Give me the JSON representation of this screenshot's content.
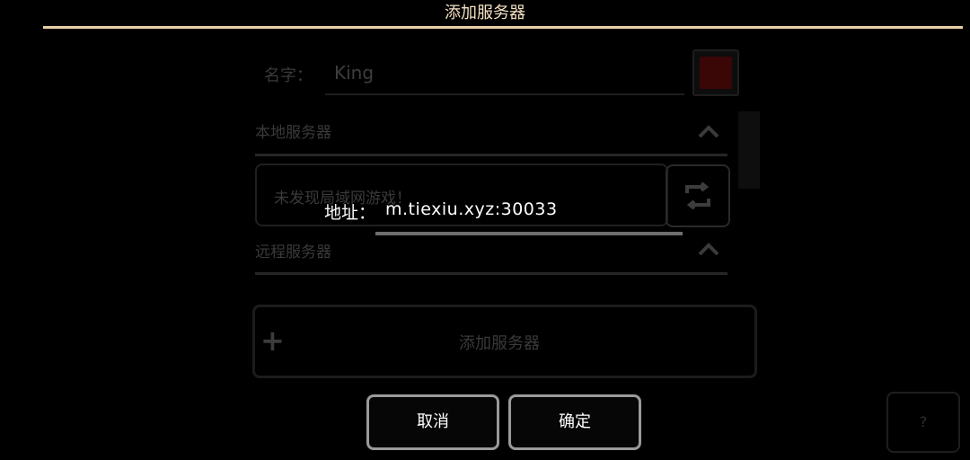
{
  "header": {
    "title": "添加服务器"
  },
  "form": {
    "name_label": "名字：",
    "name_value": "King",
    "address_label": "地址：",
    "address_value": "m.tiexiu.xyz:30033"
  },
  "sections": {
    "local": {
      "title": "本地服务器",
      "empty_text": "未发现局域网游戏！"
    },
    "remote": {
      "title": "远程服务器"
    }
  },
  "buttons": {
    "add_server": "添加服务器",
    "add_icon": "+",
    "cancel": "取消",
    "confirm": "确定",
    "help": "?"
  },
  "colors": {
    "accent": "#e8cfa4",
    "selected_color": "#3a0606",
    "background": "#000000"
  },
  "icons": [
    "chevron-up-icon",
    "refresh-icon",
    "plus-icon"
  ]
}
